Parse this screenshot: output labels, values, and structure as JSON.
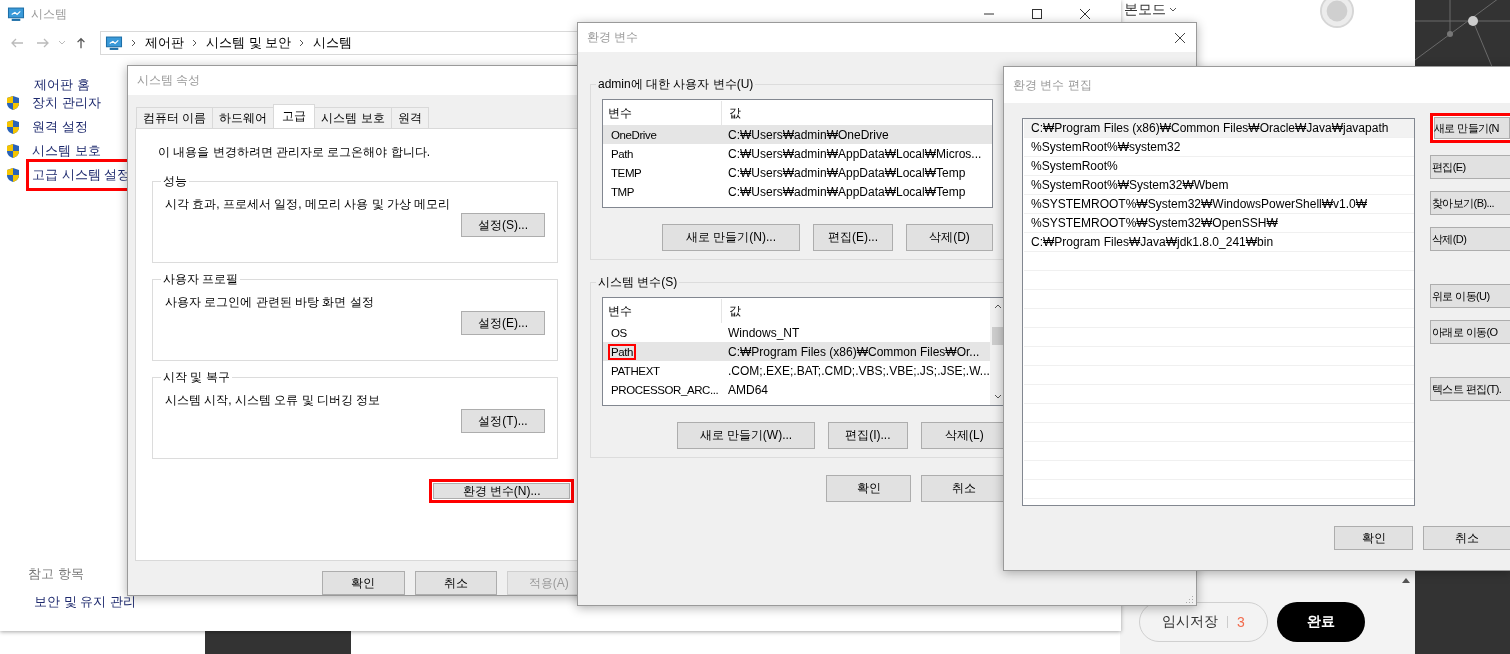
{
  "editor": {
    "mode_label": "본모드",
    "draft_button": {
      "label": "임시저장",
      "count": "3"
    },
    "done_button": "완료"
  },
  "system_window": {
    "title": "시스템",
    "breadcrumb": [
      "제어판",
      "시스템 및 보안",
      "시스템"
    ],
    "sidebar": {
      "home": "제어판 홈",
      "items": [
        {
          "label": "장치 관리자",
          "highlighted": false
        },
        {
          "label": "원격 설정",
          "highlighted": false
        },
        {
          "label": "시스템 보호",
          "highlighted": false
        },
        {
          "label": "고급 시스템 설정",
          "highlighted": true
        }
      ],
      "see_also_title": "참고 항목",
      "see_also": [
        "보안 및 유지 관리"
      ]
    }
  },
  "system_properties": {
    "title": "시스템 속성",
    "tabs": [
      {
        "label": "컴퓨터 이름",
        "selected": false
      },
      {
        "label": "하드웨어",
        "selected": false
      },
      {
        "label": "고급",
        "selected": true
      },
      {
        "label": "시스템 보호",
        "selected": false
      },
      {
        "label": "원격",
        "selected": false
      }
    ],
    "notice": "이 내용을 변경하려면 관리자로 로그온해야 합니다.",
    "groups": [
      {
        "title": "성능",
        "description": "시각 효과, 프로세서 일정, 메모리 사용 및 가상 메모리",
        "button": "설정(S)..."
      },
      {
        "title": "사용자 프로필",
        "description": "사용자 로그인에 관련된 바탕 화면 설정",
        "button": "설정(E)..."
      },
      {
        "title": "시작 및 복구",
        "description": "시스템 시작, 시스템 오류 및 디버깅 정보",
        "button": "설정(T)..."
      }
    ],
    "env_button": {
      "label": "환경 변수(N)...",
      "highlighted": true
    },
    "buttons": [
      {
        "label": "확인",
        "disabled": false
      },
      {
        "label": "취소",
        "disabled": false
      },
      {
        "label": "적용(A)",
        "disabled": true
      }
    ]
  },
  "env_vars": {
    "title": "환경 변수",
    "user_group": {
      "title": "admin에 대한 사용자 변수(U)",
      "columns": [
        "변수",
        "값"
      ],
      "rows": [
        {
          "name": "OneDrive",
          "value": "C:₩Users₩admin₩OneDrive",
          "selected": true,
          "highlighted": false
        },
        {
          "name": "Path",
          "value": "C:₩Users₩admin₩AppData₩Local₩Micros...",
          "selected": false,
          "highlighted": false
        },
        {
          "name": "TEMP",
          "value": "C:₩Users₩admin₩AppData₩Local₩Temp",
          "selected": false,
          "highlighted": false
        },
        {
          "name": "TMP",
          "value": "C:₩Users₩admin₩AppData₩Local₩Temp",
          "selected": false,
          "highlighted": false
        }
      ],
      "buttons": [
        "새로 만들기(N)...",
        "편집(E)...",
        "삭제(D)"
      ]
    },
    "system_group": {
      "title": "시스템 변수(S)",
      "columns": [
        "변수",
        "값"
      ],
      "rows": [
        {
          "name": "OS",
          "value": "Windows_NT",
          "selected": false,
          "highlighted": false
        },
        {
          "name": "Path",
          "value": "C:₩Program Files (x86)₩Common Files₩Or...",
          "selected": true,
          "highlighted": true
        },
        {
          "name": "PATHEXT",
          "value": ".COM;.EXE;.BAT;.CMD;.VBS;.VBE;.JS;.JSE;.W...",
          "selected": false,
          "highlighted": false
        },
        {
          "name": "PROCESSOR_ARC...",
          "value": "AMD64",
          "selected": false,
          "highlighted": false
        }
      ],
      "buttons": [
        "새로 만들기(W)...",
        "편집(I)...",
        "삭제(L)"
      ]
    },
    "buttons": [
      "확인",
      "취소"
    ]
  },
  "edit_env": {
    "title": "환경 변수 편집",
    "entries": [
      {
        "text": "C:₩Program Files (x86)₩Common Files₩Oracle₩Java₩javapath",
        "selected": true
      },
      {
        "text": "%SystemRoot%₩system32",
        "selected": false
      },
      {
        "text": "%SystemRoot%",
        "selected": false
      },
      {
        "text": "%SystemRoot%₩System32₩Wbem",
        "selected": false
      },
      {
        "text": "%SYSTEMROOT%₩System32₩WindowsPowerShell₩v1.0₩",
        "selected": false
      },
      {
        "text": "%SYSTEMROOT%₩System32₩OpenSSH₩",
        "selected": false
      },
      {
        "text": "C:₩Program Files₩Java₩jdk1.8.0_241₩bin",
        "selected": false
      }
    ],
    "side_button_groups": [
      [
        {
          "label": "새로 만들기(N",
          "highlighted": true
        },
        {
          "label": "편집(E)",
          "highlighted": false
        },
        {
          "label": "찾아보기(B)...",
          "highlighted": false
        },
        {
          "label": "삭제(D)",
          "highlighted": false
        }
      ],
      [
        {
          "label": "위로 이동(U)",
          "highlighted": false
        },
        {
          "label": "아래로 이동(O",
          "highlighted": false
        }
      ],
      [
        {
          "label": "텍스트 편집(T).",
          "highlighted": false
        }
      ]
    ],
    "buttons": [
      "확인",
      "취소"
    ]
  }
}
